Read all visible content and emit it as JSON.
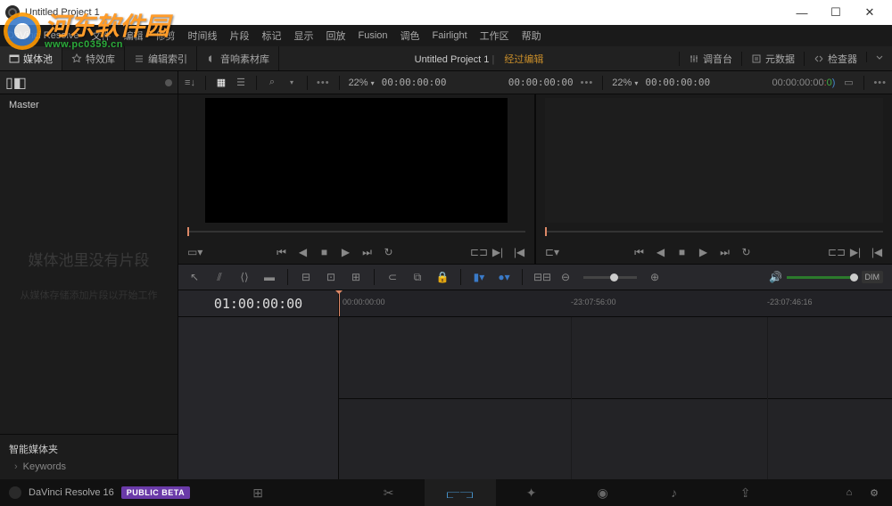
{
  "titlebar": {
    "title": "Untitled Project 1"
  },
  "menubar": [
    "DaVinci Resolve",
    "文件",
    "编辑",
    "修剪",
    "时间线",
    "片段",
    "标记",
    "显示",
    "回放",
    "Fusion",
    "调色",
    "Fairlight",
    "工作区",
    "帮助"
  ],
  "toolbar2": {
    "media_pool": "媒体池",
    "effects": "特效库",
    "edit_index": "编辑索引",
    "sound_lib": "音响素材库",
    "project": "Untitled Project 1",
    "status": "经过编辑",
    "mixer": "调音台",
    "metadata": "元数据",
    "inspector": "检查器"
  },
  "media_tools": {
    "zoom_left": "22%",
    "tc_left": "00:00:00:00",
    "tc_left2": "00:00:00:00",
    "zoom_right": "22%",
    "tc_right": "00:00:00:00",
    "tc_right2": "00:00:00:00"
  },
  "left_panel": {
    "master": "Master",
    "empty_msg": "媒体池里没有片段",
    "empty_sub": "从媒体存储添加片段以开始工作",
    "smart_header": "智能媒体夹",
    "keywords": "Keywords"
  },
  "edit_tools": {
    "dim": "DIM"
  },
  "timeline": {
    "tc": "01:00:00:00",
    "ticks": [
      "00:00:00:00",
      "-23:07:56:00",
      "-23:07:46:16"
    ]
  },
  "bottom": {
    "app": "DaVinci Resolve 16",
    "beta": "PUBLIC BETA"
  },
  "watermark": {
    "site": "河东软件园",
    "url": "www.pc0359.cn"
  }
}
